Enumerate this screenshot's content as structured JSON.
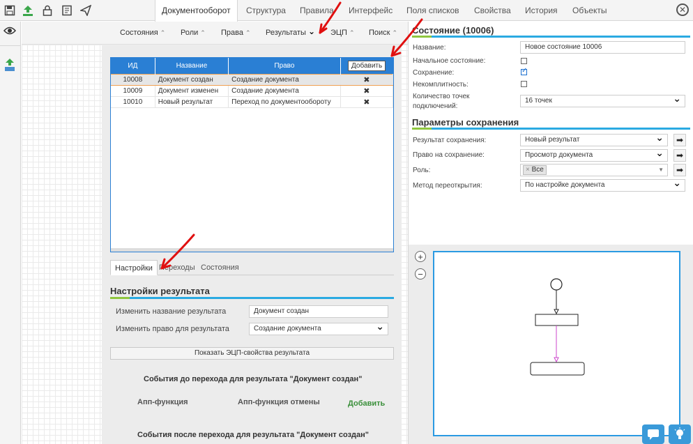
{
  "toolbar": {
    "icons": [
      "save-icon",
      "upload-icon",
      "lock-icon",
      "document-icon",
      "send-icon"
    ]
  },
  "tabs": [
    {
      "label": "Документооборот",
      "active": true
    },
    {
      "label": "Структура"
    },
    {
      "label": "Правила"
    },
    {
      "label": "Интерфейс"
    },
    {
      "label": "Поля списков"
    },
    {
      "label": "Свойства"
    },
    {
      "label": "История"
    },
    {
      "label": "Объекты"
    }
  ],
  "close_glyph": "✕",
  "section_nav": [
    {
      "label": "Состояния",
      "chev": "⌃"
    },
    {
      "label": "Роли",
      "chev": "⌃"
    },
    {
      "label": "Права",
      "chev": "⌃"
    },
    {
      "label": "Результаты",
      "chev": "⌄"
    },
    {
      "label": "ЭЦП",
      "chev": "⌃"
    },
    {
      "label": "Поиск",
      "chev": "⌃"
    }
  ],
  "table": {
    "headers": [
      "ИД",
      "Название",
      "Право"
    ],
    "add_button": "Добавить",
    "rows": [
      {
        "id": "10008",
        "name": "Документ создан",
        "right": "Создание документа",
        "del": "✖"
      },
      {
        "id": "10009",
        "name": "Документ изменен",
        "right": "Создание документа",
        "del": "✖"
      },
      {
        "id": "10010",
        "name": "Новый результат",
        "right": "Переход по документообороту",
        "del": "✖"
      }
    ]
  },
  "bottom_tabs": [
    {
      "label": "Настройки",
      "active": true
    },
    {
      "label": "Переходы"
    },
    {
      "label": "Состояния"
    }
  ],
  "result_settings": {
    "title": "Настройки результата",
    "rename_label": "Изменить название результата",
    "rename_value": "Документ создан",
    "right_label": "Изменить право для результата",
    "right_value": "Создание документа",
    "show_ecp_button": "Показать ЭЦП-свойства результата",
    "events_before_title": "События до перехода для результата \"Документ создан\"",
    "app_function": "Апп-функция",
    "app_function_cancel": "Апп-функция отмены",
    "add_link": "Добавить",
    "events_after_title": "События после перехода для результата \"Документ создан\""
  },
  "state_panel": {
    "title": "Состояние (10006)",
    "name_label": "Название:",
    "name_value": "Новое состояние 10006",
    "initial_label": "Начальное состояние:",
    "initial_checked": false,
    "save_label": "Сохранение:",
    "save_checked": true,
    "incomplete_label": "Некомплитность:",
    "incomplete_checked": false,
    "points_label_1": "Количество точек",
    "points_label_2": "подключений:",
    "points_value": "16 точек"
  },
  "save_params": {
    "title": "Параметры сохранения",
    "result_label": "Результат сохранения:",
    "result_value": "Новый результат",
    "right_label": "Право на сохранение:",
    "right_value": "Просмотр документа",
    "role_label": "Роль:",
    "role_tag": "Все",
    "role_tag_x": "×",
    "reopen_label": "Метод переоткрытия:",
    "reopen_value": "По настройке документа",
    "arrow": "➡"
  },
  "diagram": {
    "zoom_in": "+",
    "zoom_out": "−"
  },
  "colors": {
    "accent_blue": "#2a7fd4",
    "green": "#3a8f3a",
    "annotation_red": "#e01010",
    "transition_magenta": "#cc44cc"
  }
}
